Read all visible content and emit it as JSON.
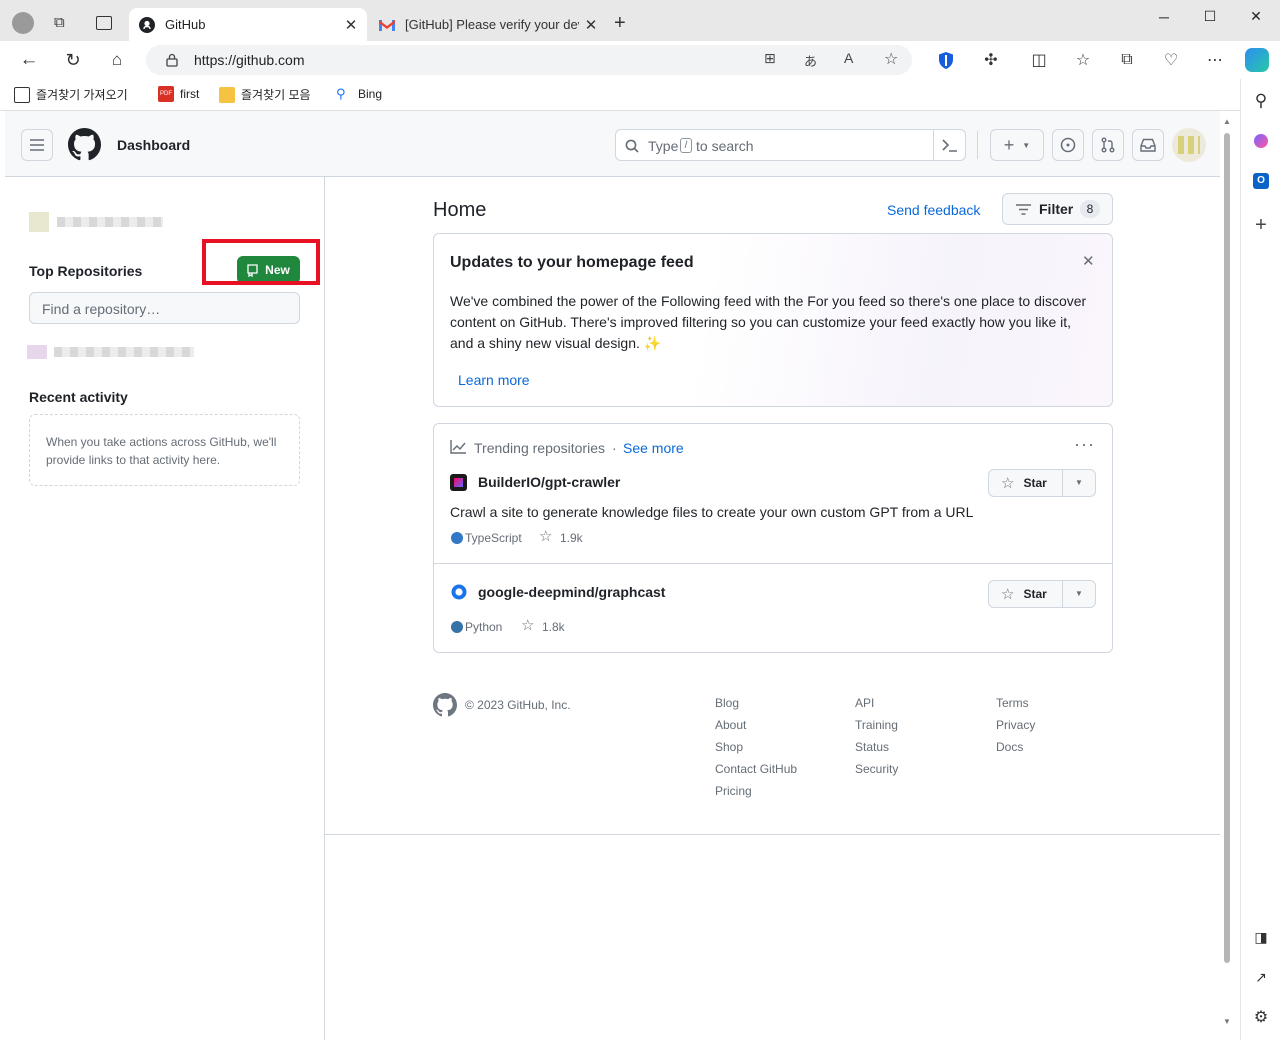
{
  "browser": {
    "tabs": [
      {
        "title": "GitHub",
        "active": true
      },
      {
        "title": "[GitHub] Please verify your device",
        "active": false
      }
    ],
    "url": "https://github.com",
    "favorites": [
      {
        "label": "즐겨찾기 가져오기",
        "icon": "import-icon"
      },
      {
        "label": "first",
        "icon": "pdf-icon"
      },
      {
        "label": "즐겨찾기 모음",
        "icon": "folder-icon"
      },
      {
        "label": "Bing",
        "icon": "search-icon"
      }
    ]
  },
  "header": {
    "context": "Dashboard",
    "search_placeholder_pre": "Type",
    "search_key": "/",
    "search_placeholder_post": "to search"
  },
  "left": {
    "top_repos_title": "Top Repositories",
    "new_button": "New",
    "find_placeholder": "Find a repository…",
    "recent_title": "Recent activity",
    "recent_empty": "When you take actions across GitHub, we'll provide links to that activity here."
  },
  "feed": {
    "title": "Home",
    "send_feedback": "Send feedback",
    "filter_label": "Filter",
    "filter_count": "8",
    "updates": {
      "title": "Updates to your homepage feed",
      "body": "We've combined the power of the Following feed with the For you feed so there's one place to discover content on GitHub. There's improved filtering so you can customize your feed exactly how you like it, and a shiny new visual design. ✨",
      "learn_more": "Learn more"
    },
    "trending": {
      "title": "Trending repositories",
      "separator": "·",
      "see_more": "See more",
      "repos": [
        {
          "name": "BuilderIO/gpt-crawler",
          "description": "Crawl a site to generate knowledge files to create your own custom GPT from a URL",
          "language": "TypeScript",
          "lang_color": "#3178c6",
          "stars": "1.9k",
          "star_label": "Star"
        },
        {
          "name": "google-deepmind/graphcast",
          "description": "",
          "language": "Python",
          "lang_color": "#3572A5",
          "stars": "1.8k",
          "star_label": "Star"
        }
      ]
    }
  },
  "footer": {
    "copyright": "© 2023 GitHub, Inc.",
    "col1": [
      "Blog",
      "About",
      "Shop",
      "Contact GitHub",
      "Pricing"
    ],
    "col2": [
      "API",
      "Training",
      "Status",
      "Security"
    ],
    "col3": [
      "Terms",
      "Privacy",
      "Docs"
    ]
  },
  "colors": {
    "accent": "#0969da",
    "green": "#1f883d",
    "highlight": "#e81123"
  }
}
